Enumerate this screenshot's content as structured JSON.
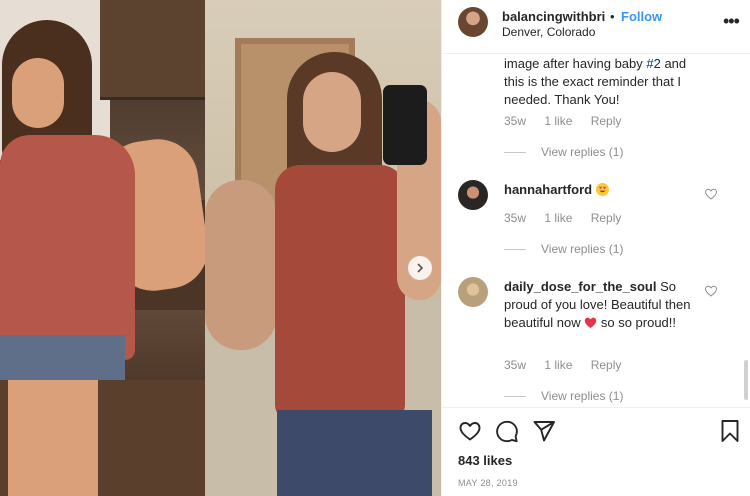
{
  "post": {
    "username": "balancingwithbri",
    "dot": "•",
    "follow_label": "Follow",
    "location": "Denver, Colorado",
    "likes": "843 likes",
    "date": "MAY 28, 2019"
  },
  "comments": [
    {
      "username": "",
      "text_before_tag": "image after having baby ",
      "tag": "#2",
      "text_after_tag": " and this is the exact reminder that I needed. Thank You!",
      "age": "35w",
      "likes": "1 like",
      "reply_label": "Reply",
      "view_replies": "View replies (1)"
    },
    {
      "username": "hannahartford",
      "text": "",
      "emoji": "smiling-face-with-heart-eyes",
      "age": "35w",
      "likes": "1 like",
      "reply_label": "Reply",
      "view_replies": "View replies (1)"
    },
    {
      "username": "daily_dose_for_the_soul",
      "text_before_emoji": " So proud of you love! Beautiful then beautiful now ",
      "emoji": "red-heart",
      "text_after_emoji": " so so proud!!",
      "age": "35w",
      "likes": "1 like",
      "reply_label": "Reply",
      "view_replies": "View replies (1)"
    }
  ],
  "colors": {
    "link_blue": "#3897f0",
    "hashtag": "#003569",
    "text": "#262626",
    "muted": "#8e8e8e",
    "heart_red": "#ed4956"
  },
  "icons": [
    "more-options-icon",
    "carousel-next-icon",
    "heart-icon",
    "comment-icon",
    "share-icon",
    "bookmark-icon",
    "like-comment-heart-icon"
  ]
}
